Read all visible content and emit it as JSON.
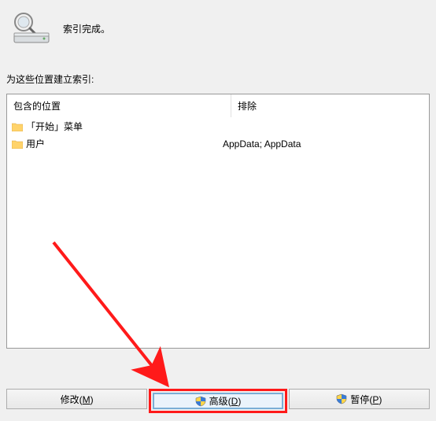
{
  "status": {
    "text": "索引完成。"
  },
  "section_label": "为这些位置建立索引:",
  "columns": {
    "included": "包含的位置",
    "excluded": "排除"
  },
  "rows": [
    {
      "name": "「开始」菜单",
      "excluded": ""
    },
    {
      "name": "用户",
      "excluded": "AppData; AppData"
    }
  ],
  "buttons": {
    "modify": {
      "label": "修改",
      "accel": "M"
    },
    "advanced": {
      "label": "高级",
      "accel": "D"
    },
    "pause": {
      "label": "暂停",
      "accel": "P"
    }
  }
}
